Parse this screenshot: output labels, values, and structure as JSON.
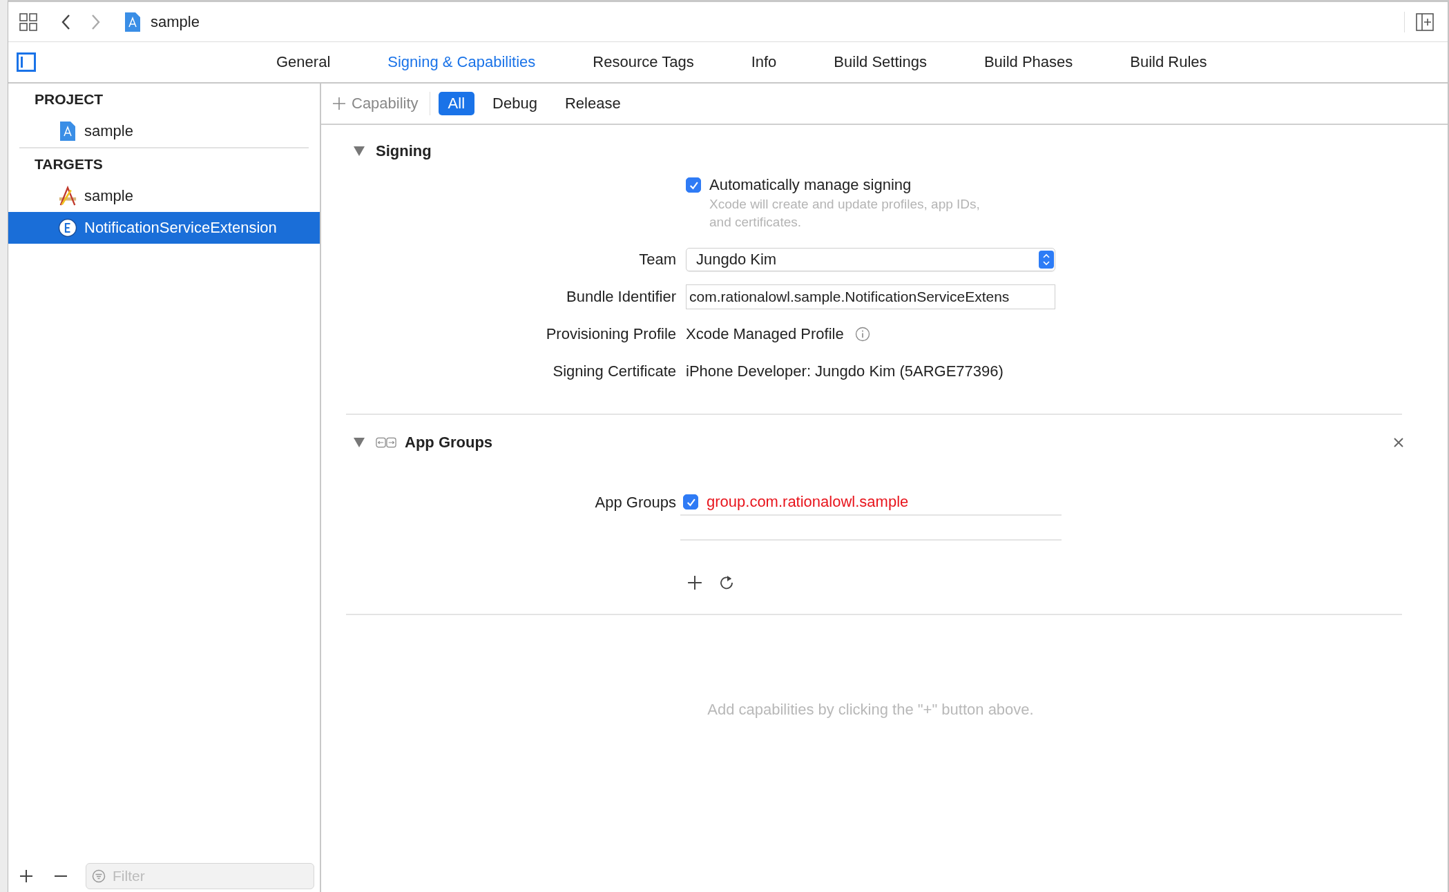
{
  "toolbar": {
    "breadcrumb": "sample"
  },
  "tabs": [
    {
      "label": "General",
      "selected": false
    },
    {
      "label": "Signing & Capabilities",
      "selected": true
    },
    {
      "label": "Resource Tags",
      "selected": false
    },
    {
      "label": "Info",
      "selected": false
    },
    {
      "label": "Build Settings",
      "selected": false
    },
    {
      "label": "Build Phases",
      "selected": false
    },
    {
      "label": "Build Rules",
      "selected": false
    }
  ],
  "sidebar": {
    "sections": [
      {
        "title": "PROJECT",
        "items": [
          {
            "label": "sample",
            "kind": "project",
            "selected": false
          }
        ]
      },
      {
        "title": "TARGETS",
        "items": [
          {
            "label": "sample",
            "kind": "app",
            "selected": false
          },
          {
            "label": "NotificationServiceExtension",
            "kind": "extension",
            "selected": true
          }
        ]
      }
    ],
    "filter": {
      "placeholder": "Filter"
    }
  },
  "capability_bar": {
    "add_label": "Capability",
    "filters": [
      {
        "label": "All",
        "selected": true
      },
      {
        "label": "Debug",
        "selected": false
      },
      {
        "label": "Release",
        "selected": false
      }
    ]
  },
  "signing": {
    "title": "Signing",
    "expanded": true,
    "auto_manage": {
      "label": "Automatically manage signing",
      "checked": true,
      "note": "Xcode will create and update profiles, app IDs, and certificates."
    },
    "fields": [
      {
        "label": "Team",
        "kind": "popup",
        "value": "Jungdo Kim"
      },
      {
        "label": "Bundle Identifier",
        "kind": "text",
        "value": "com.rationalowl.sample.NotificationServiceExtens"
      },
      {
        "label": "Provisioning Profile",
        "kind": "info",
        "value": "Xcode Managed Profile"
      },
      {
        "label": "Signing Certificate",
        "kind": "plain",
        "value": "iPhone Developer: Jungdo Kim (5ARGE77396)"
      }
    ]
  },
  "app_groups": {
    "title": "App Groups",
    "expanded": true,
    "label": "App Groups",
    "groups": [
      {
        "name": "group.com.rationalowl.sample",
        "checked": true,
        "error": true
      }
    ]
  },
  "empty_hint": "Add capabilities by clicking the \"+\" button above."
}
